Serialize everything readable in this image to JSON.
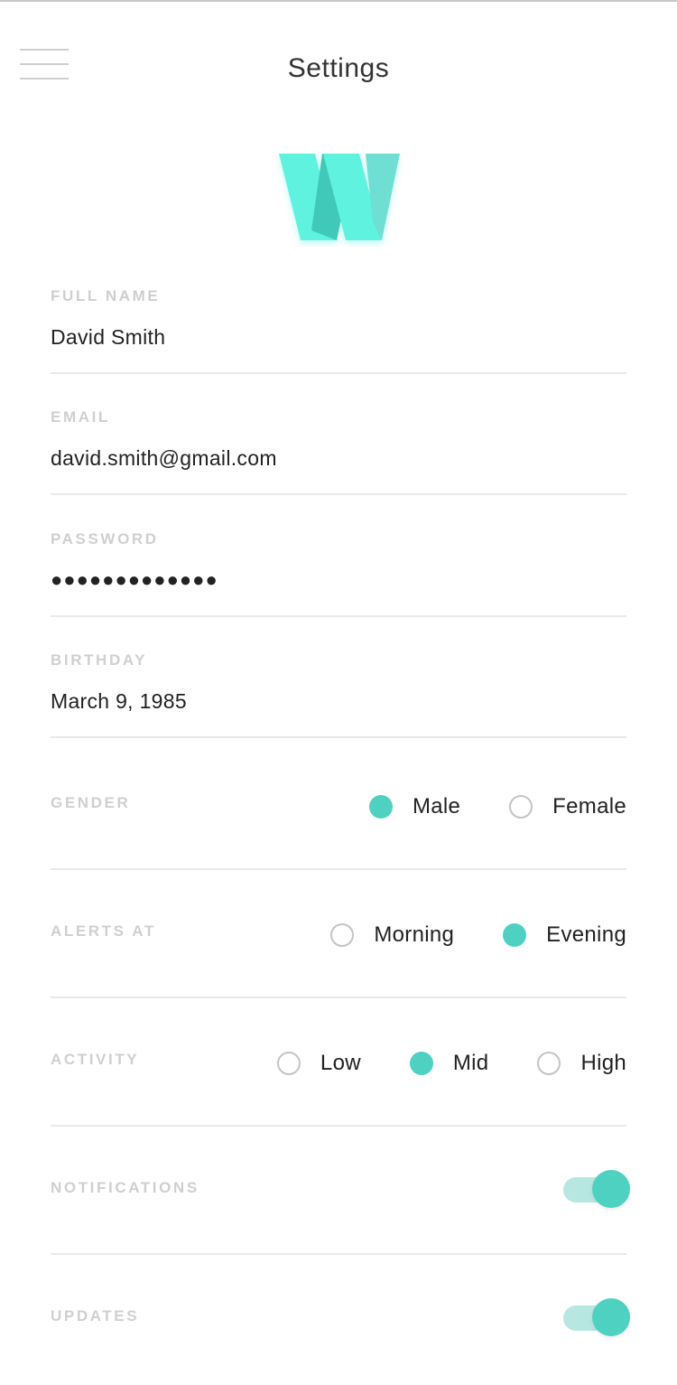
{
  "header": {
    "title": "Settings",
    "menu_icon": "hamburger-menu-icon"
  },
  "logo": {
    "letter": "W",
    "color": "#5ef2df"
  },
  "fields": {
    "full_name": {
      "label": "FULL NAME",
      "value": "David Smith"
    },
    "email": {
      "label": "EMAIL",
      "value": "david.smith@gmail.com"
    },
    "password": {
      "label": "PASSWORD",
      "value": "●●●●●●●●●●●●●"
    },
    "birthday": {
      "label": "BIRTHDAY",
      "value": "March 9, 1985"
    }
  },
  "gender": {
    "label": "GENDER",
    "options": [
      "Male",
      "Female"
    ],
    "selected": "Male"
  },
  "alerts": {
    "label": "ALERTS AT",
    "options": [
      "Morning",
      "Evening"
    ],
    "selected": "Evening"
  },
  "activity": {
    "label": "ACTIVITY",
    "options": [
      "Low",
      "Mid",
      "High"
    ],
    "selected": "Mid"
  },
  "notifications": {
    "label": "NOTIFICATIONS",
    "enabled": true
  },
  "updates": {
    "label": "UPDATES",
    "enabled": true
  },
  "colors": {
    "accent": "#4fd1c1",
    "accent_light": "#b7e7e0",
    "label": "#cfcfcf",
    "divider": "#e9e9e9"
  }
}
